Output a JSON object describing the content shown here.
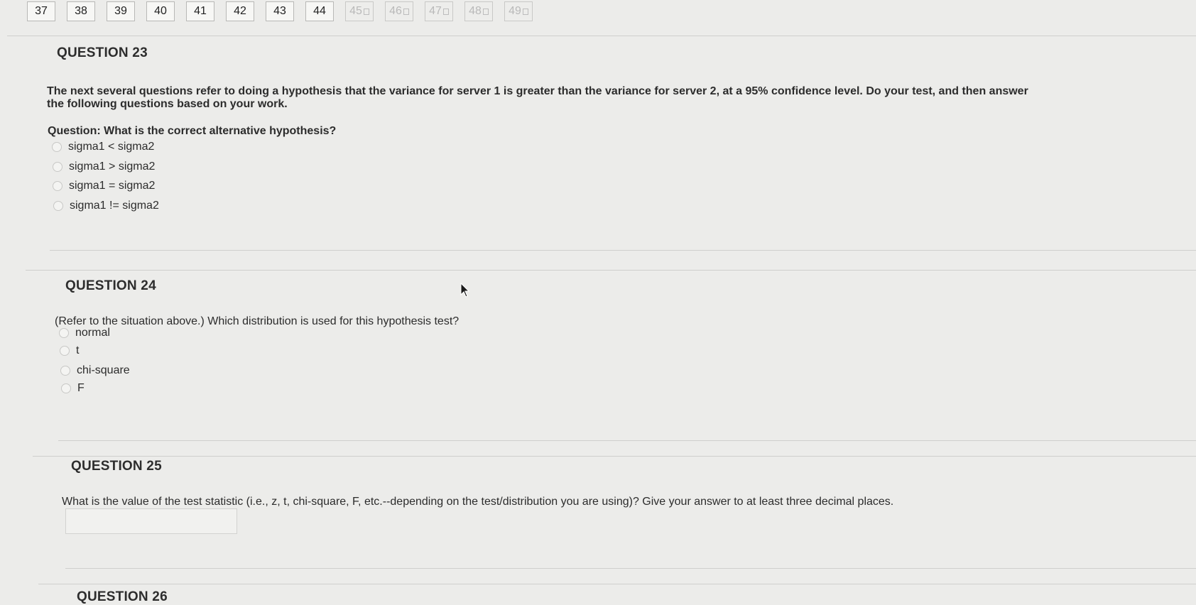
{
  "nav": [
    {
      "label": "37",
      "saved": false
    },
    {
      "label": "38",
      "saved": false
    },
    {
      "label": "39",
      "saved": false
    },
    {
      "label": "40",
      "saved": false
    },
    {
      "label": "41",
      "saved": false
    },
    {
      "label": "42",
      "saved": false
    },
    {
      "label": "43",
      "saved": false
    },
    {
      "label": "44",
      "saved": false
    },
    {
      "label": "45",
      "saved": true
    },
    {
      "label": "46",
      "saved": true
    },
    {
      "label": "47",
      "saved": true
    },
    {
      "label": "48",
      "saved": true
    },
    {
      "label": "49",
      "saved": true
    }
  ],
  "q23": {
    "title": "QUESTION 23",
    "intro_line1": "The next several questions refer to doing a hypothesis that the variance for server 1 is greater than the variance for server 2, at a 95% confidence level. Do your test, and then answer",
    "intro_line2": "the following questions based on your work.",
    "prompt": "Question: What is the correct alternative hypothesis?",
    "options": [
      "sigma1 < sigma2",
      "sigma1 > sigma2",
      "sigma1 = sigma2",
      "sigma1 != sigma2"
    ]
  },
  "q24": {
    "title": "QUESTION 24",
    "prompt": "(Refer to the situation above.) Which distribution is used for this hypothesis test?",
    "options": [
      "normal",
      "t",
      "chi-square",
      "F"
    ]
  },
  "q25": {
    "title": "QUESTION 25",
    "prompt": "What is the value of the test statistic (i.e., z, t, chi-square, F, etc.--depending on the test/distribution you are using)? Give your answer to at least three decimal places.",
    "answer_value": ""
  },
  "q26": {
    "title": "QUESTION 26"
  },
  "colors": {
    "background": "#ececea",
    "saved_text": "#b9b9b9"
  }
}
